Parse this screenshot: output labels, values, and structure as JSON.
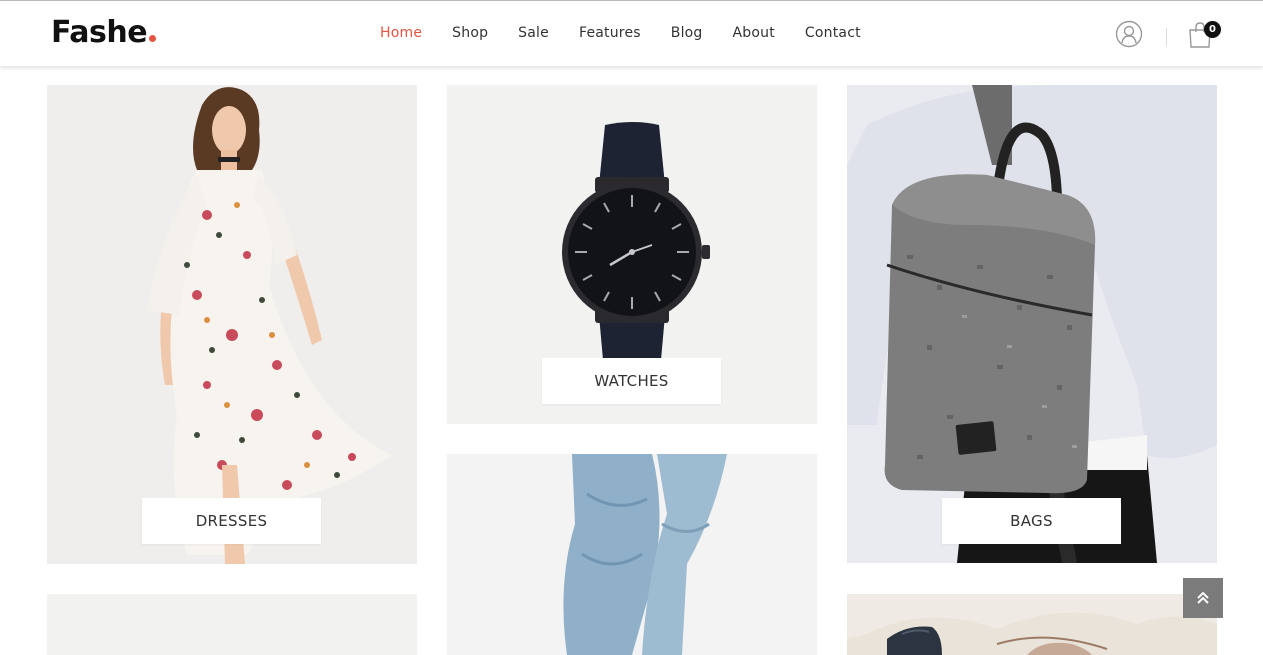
{
  "brand": {
    "name": "Fashe",
    "accent": "#e65540"
  },
  "nav": {
    "items": [
      {
        "label": "Home",
        "active": true
      },
      {
        "label": "Shop"
      },
      {
        "label": "Sale"
      },
      {
        "label": "Features"
      },
      {
        "label": "Blog"
      },
      {
        "label": "About"
      },
      {
        "label": "Contact"
      }
    ]
  },
  "header_icons": {
    "user": "user-circle-icon",
    "cart": "shopping-bag-icon",
    "cart_count": "0"
  },
  "categories": [
    {
      "label": "DRESSES",
      "image": "dress-model-photo"
    },
    {
      "label": "WATCHES",
      "image": "black-watch-photo"
    },
    {
      "label": "BAGS",
      "image": "grey-backpack-photo"
    },
    {
      "label": "",
      "image": "jeans-photo"
    },
    {
      "label": "",
      "image": "sunglasses-photo"
    }
  ],
  "scroll_top": {
    "icon": "double-chevron-up-icon"
  }
}
